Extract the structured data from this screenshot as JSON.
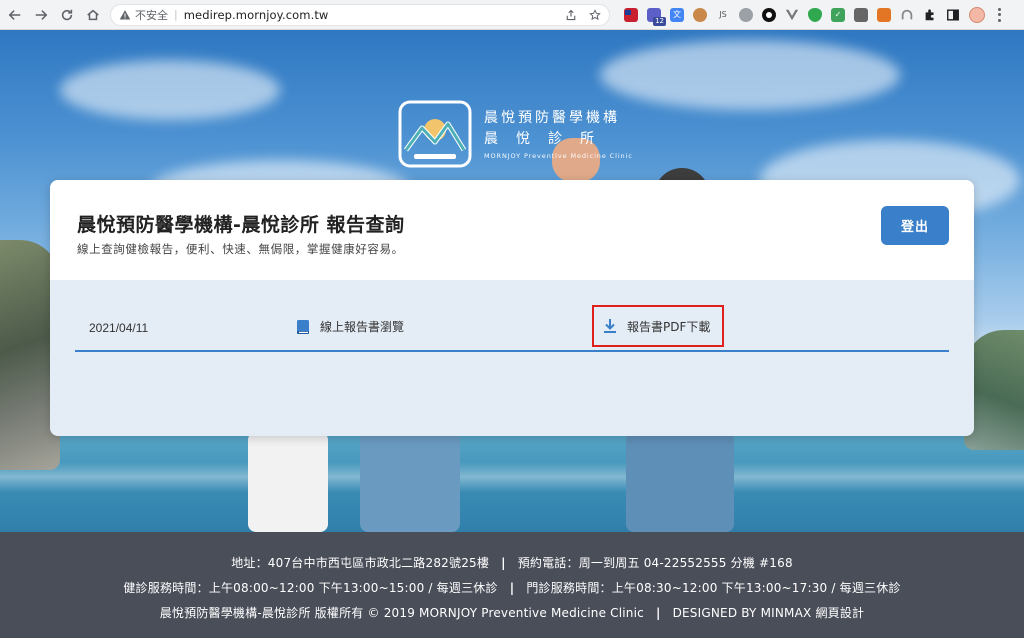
{
  "browser": {
    "insecure_label": "不安全",
    "url": "medirep.mornjoy.com.tw",
    "extension_badge": "12"
  },
  "logo": {
    "zh_line1": "晨悅預防醫學機構",
    "zh_line2": "晨悅診所",
    "en_line": "MORNJOY Preventive Medicine Clinic"
  },
  "card": {
    "title": "晨悅預防醫學機構-晨悅診所 報告查詢",
    "subtitle": "線上查詢健檢報告，便利、快速、無侷限，掌握健康好容易。",
    "logout_label": "登出",
    "report": {
      "date": "2021/04/11",
      "view_label": "線上報告書瀏覽",
      "download_label": "報告書PDF下載"
    }
  },
  "footer": {
    "address": "地址：407台中市西屯區市政北二路282號25樓",
    "booking": "預約電話：周一到周五 04-22552555 分機 #168",
    "checkup_hours": "健診服務時間：上午08:00~12:00 下午13:00~15:00 / 每週三休診",
    "clinic_hours": "門診服務時間：上午08:30~12:00 下午13:00~17:30 / 每週三休診",
    "copyright": "晨悅預防醫學機構-晨悅診所 版權所有 © 2019 MORNJOY Preventive Medicine Clinic",
    "designer": "DESIGNED BY MINMAX 網頁設計",
    "separator": "|"
  },
  "colors": {
    "primary": "#3a7fc9",
    "highlight_border": "#e0201c",
    "footer_bg": "#4a4e59",
    "card_body_bg": "#e4ecf5"
  },
  "icons": [
    "back-icon",
    "forward-icon",
    "reload-icon",
    "home-icon",
    "warning-icon",
    "share-icon",
    "star-icon",
    "book-icon",
    "download-icon",
    "kebab-menu-icon"
  ]
}
